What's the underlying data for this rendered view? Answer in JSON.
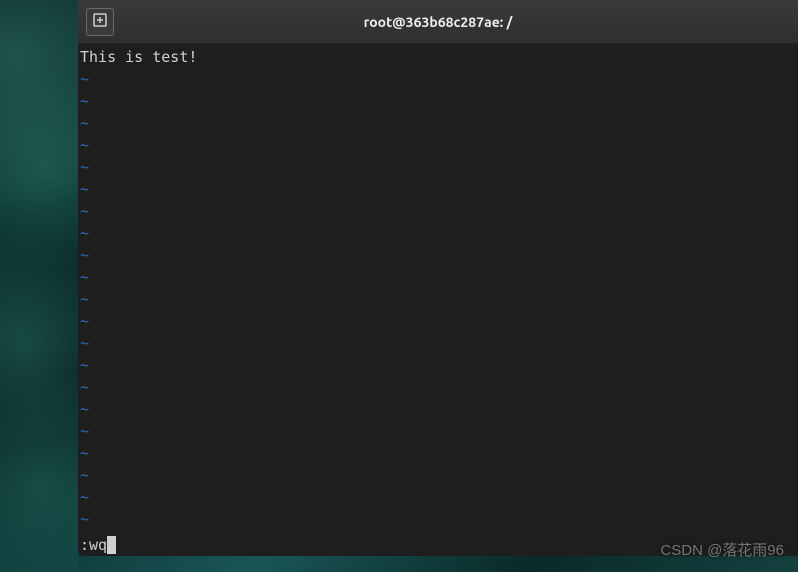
{
  "titlebar": {
    "title": "root@363b68c287ae: /"
  },
  "editor": {
    "content": "This is test!",
    "tilde_char": "~",
    "tilde_count": 21,
    "command": ":wq"
  },
  "watermark": "CSDN @落花雨96"
}
